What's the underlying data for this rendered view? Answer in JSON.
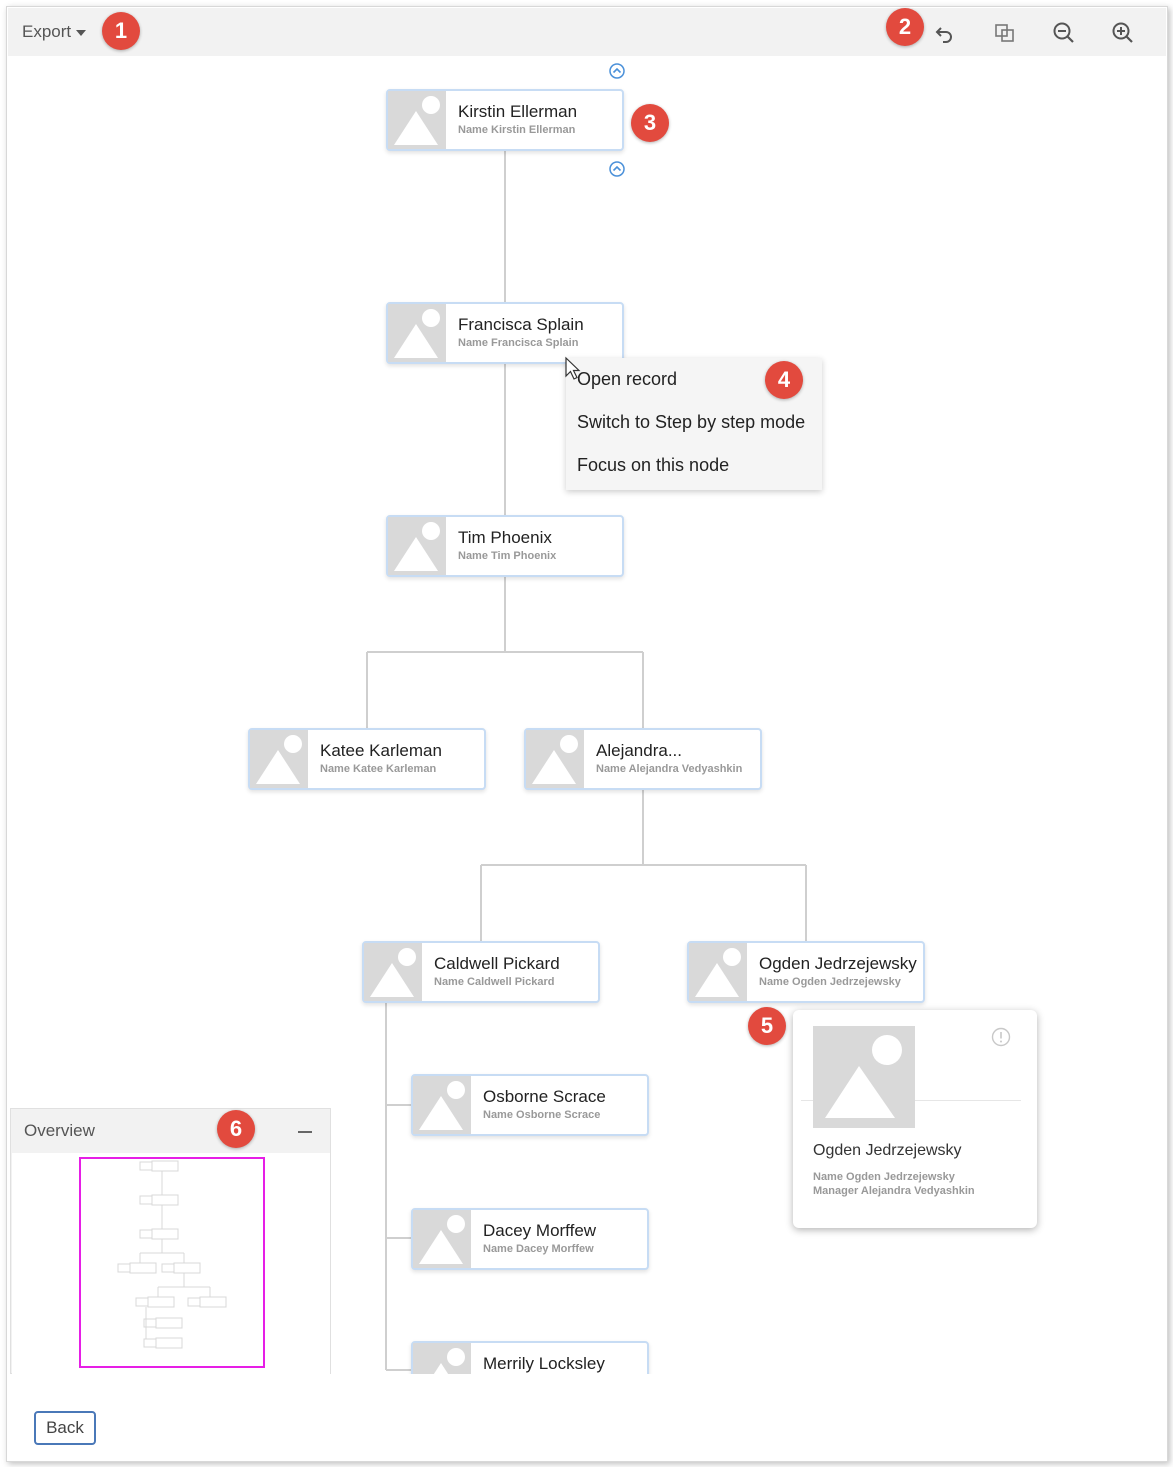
{
  "toolbar": {
    "export_label": "Export",
    "undo_icon": "undo-icon",
    "fit_icon": "fit-to-screen-icon",
    "zoom_out_icon": "zoom-out-icon",
    "zoom_in_icon": "zoom-in-icon"
  },
  "badges": [
    "1",
    "2",
    "3",
    "4",
    "5",
    "6"
  ],
  "nodes": {
    "kirstin": {
      "title": "Kirstin Ellerman",
      "sub": "Name Kirstin Ellerman"
    },
    "francisca": {
      "title": "Francisca Splain",
      "sub": "Name Francisca Splain"
    },
    "tim": {
      "title": "Tim Phoenix",
      "sub": "Name Tim Phoenix"
    },
    "katee": {
      "title": "Katee Karleman",
      "sub": "Name Katee Karleman"
    },
    "alejandra": {
      "title": "Alejandra...",
      "sub": "Name Alejandra Vedyashkin"
    },
    "caldwell": {
      "title": "Caldwell Pickard",
      "sub": "Name Caldwell Pickard"
    },
    "ogden": {
      "title": "Ogden Jedrzejewsky",
      "sub": "Name Ogden Jedrzejewsky"
    },
    "osborne": {
      "title": "Osborne Scrace",
      "sub": "Name Osborne Scrace"
    },
    "dacey": {
      "title": "Dacey Morffew",
      "sub": "Name Dacey Morffew"
    },
    "merrily": {
      "title": "Merrily Locksley",
      "sub": ""
    }
  },
  "context_menu": {
    "open_record": "Open record",
    "step_mode": "Switch to Step by step mode",
    "focus": "Focus on this node"
  },
  "detail_card": {
    "name": "Ogden Jedrzejewsky",
    "line1": "Name Ogden Jedrzejewsky",
    "line2": "Manager Alejandra Vedyashkin"
  },
  "overview": {
    "title": "Overview"
  },
  "back_label": "Back",
  "colors": {
    "accent": "#4a78b8",
    "badge": "#e24a3e",
    "viewport": "#e61ee6",
    "node_border": "#c7dcf4"
  }
}
